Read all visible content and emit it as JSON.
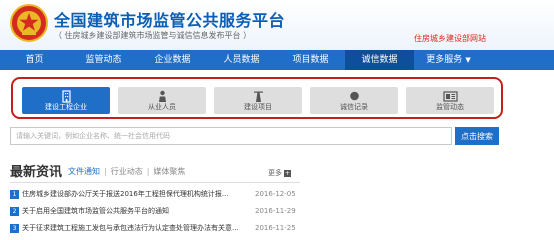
{
  "header": {
    "title": "全国建筑市场监管公共服务平台",
    "subtitle": "（ 住房城乡建设部建筑市场监管与诚信信息发布平台 ）",
    "link": "住房城乡建设部网站"
  },
  "nav": {
    "items": [
      {
        "label": "首页"
      },
      {
        "label": "监管动态"
      },
      {
        "label": "企业数据"
      },
      {
        "label": "人员数据"
      },
      {
        "label": "项目数据"
      },
      {
        "label": "诚信数据"
      },
      {
        "label": "更多服务"
      }
    ]
  },
  "categories": [
    {
      "label": "建设工程企业",
      "icon": "building-icon"
    },
    {
      "label": "从业人员",
      "icon": "person-icon"
    },
    {
      "label": "建设项目",
      "icon": "crane-icon"
    },
    {
      "label": "诚信记录",
      "icon": "medal-icon"
    },
    {
      "label": "监管动态",
      "icon": "document-icon"
    }
  ],
  "search": {
    "placeholder": "请输入关键词，例如企业名称、统一社会信用代码",
    "button_label": "点击搜索"
  },
  "news": {
    "title": "最新资讯",
    "tabs": [
      "文件通知",
      "行业动态",
      "媒体聚焦"
    ],
    "separator": "|",
    "more_label": "更多",
    "items": [
      {
        "num": "1",
        "text": "住房城乡建设部办公厅关于报送2016年工程担保代理机构统计报...",
        "date": "2016-12-05"
      },
      {
        "num": "2",
        "text": "关于启用全国建筑市场监管公共服务平台的通知",
        "date": "2016-11-29"
      },
      {
        "num": "3",
        "text": "关于征求建筑工程施工发包与承包违法行为认定查处管理办法有关意...",
        "date": "2016-11-25"
      }
    ]
  },
  "colors": {
    "brand_blue": "#1f6ec7",
    "highlight_red": "#c81e1e"
  }
}
